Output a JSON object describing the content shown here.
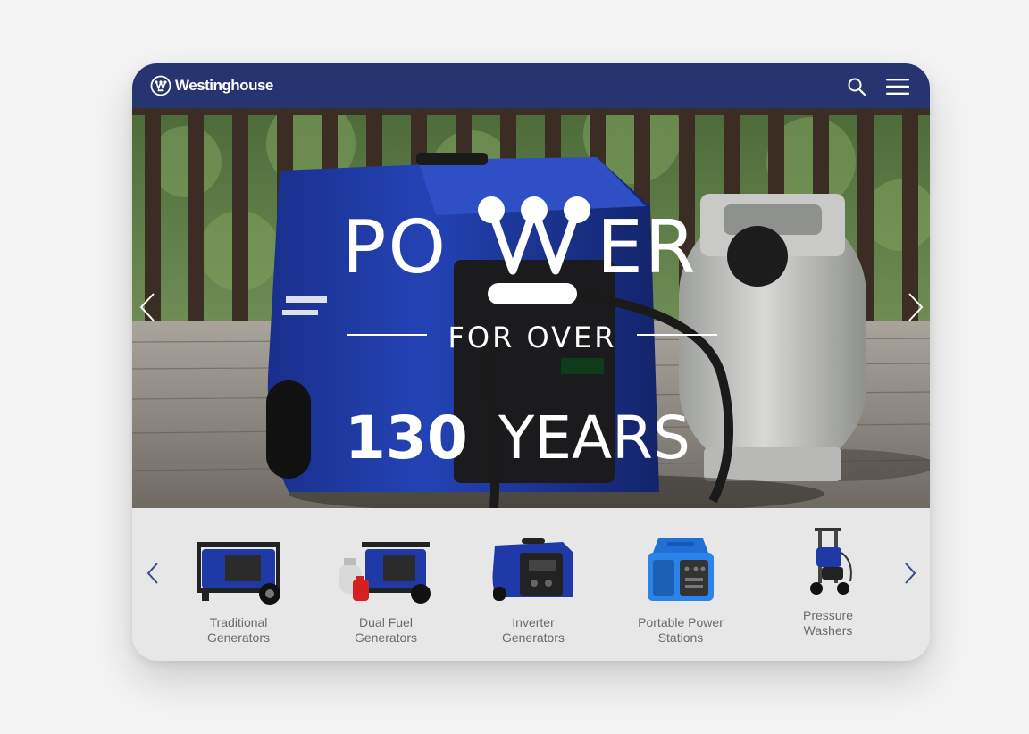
{
  "header": {
    "brand": "Westinghouse",
    "search_icon": "search-icon",
    "menu_icon": "hamburger-menu-icon"
  },
  "hero": {
    "title_top": "POWER",
    "title_middle": "FOR OVER",
    "title_number": "130",
    "title_bottom": "YEARS",
    "slide_count": 3,
    "active_slide": 1
  },
  "categories": [
    {
      "label": "Traditional\nGenerators"
    },
    {
      "label": "Dual Fuel\nGenerators"
    },
    {
      "label": "Inverter\nGenerators"
    },
    {
      "label": "Portable Power\nStations"
    },
    {
      "label": "Pressure\nWashers"
    }
  ],
  "colors": {
    "brand_navy": "#26346f",
    "product_blue": "#1f3aa7",
    "panel_gray": "#e7e7e8",
    "label_gray": "#6b6b6b"
  }
}
